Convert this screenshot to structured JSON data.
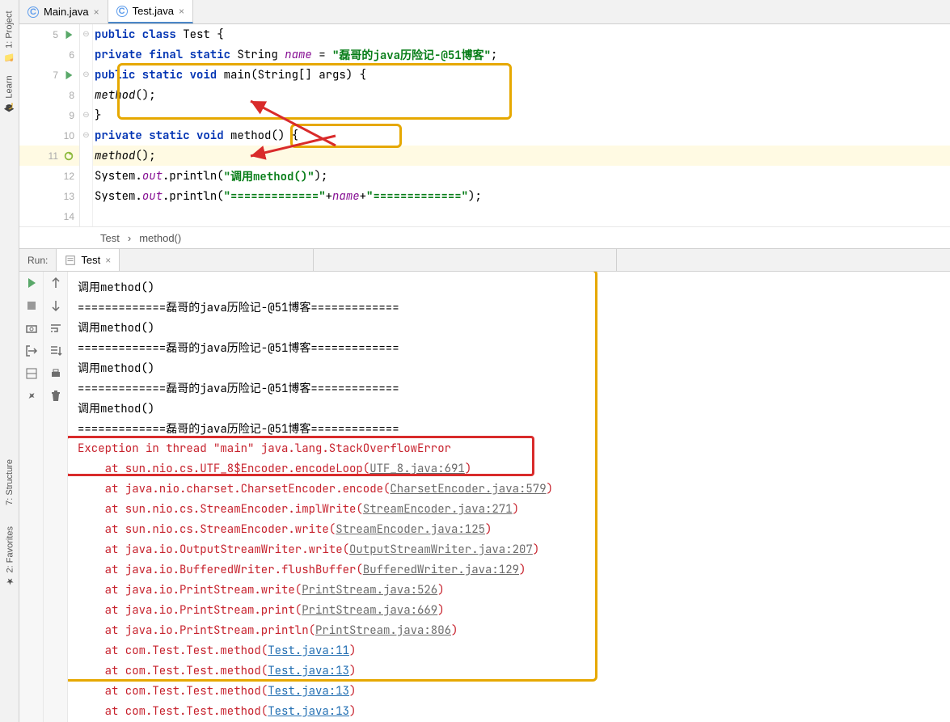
{
  "sidebar": {
    "project": "1: Project",
    "learn": "Learn",
    "structure": "7: Structure",
    "favorites": "2: Favorites"
  },
  "tabs": [
    {
      "label": "Main.java",
      "active": false
    },
    {
      "label": "Test.java",
      "active": true
    }
  ],
  "gutter": {
    "lines": [
      5,
      6,
      7,
      8,
      9,
      10,
      11,
      12,
      13,
      14
    ]
  },
  "code": {
    "l5": {
      "kw1": "public class",
      "rest": " Test {"
    },
    "l6": {
      "kw1": "private final static",
      "type": " String ",
      "fld": "name",
      "eq": " = ",
      "str": "\"磊哥的java历险记-@51博客\"",
      "semi": ";"
    },
    "l7": {
      "kw1": "public static void",
      "rest": " main(String[] args) {"
    },
    "l8": {
      "mth": "method",
      "rest": "();"
    },
    "l9": {
      "rest": "}"
    },
    "l10": {
      "kw1": "private static void",
      "mth": " method",
      "rest": "() {"
    },
    "l11": {
      "mth": "method",
      "rest": "();"
    },
    "l12": {
      "pre": "System.",
      "fld": "out",
      "mid": ".println(",
      "str": "\"调用method()\"",
      "post": ");"
    },
    "l13": {
      "pre": "System.",
      "fld": "out",
      "mid": ".println(",
      "str1": "\"=============\"",
      "plus1": "+",
      "fld2": "name",
      "plus2": "+",
      "str2": "\"=============\"",
      "post": ");"
    }
  },
  "breadcrumb": {
    "cls": "Test",
    "sep": "›",
    "mth": "method()"
  },
  "run": {
    "label": "Run:",
    "tab": "Test"
  },
  "console": [
    {
      "type": "out",
      "text": "调用method()"
    },
    {
      "type": "out",
      "text": "=============磊哥的java历险记-@51博客============="
    },
    {
      "type": "out",
      "text": "调用method()"
    },
    {
      "type": "out",
      "text": "=============磊哥的java历险记-@51博客============="
    },
    {
      "type": "out",
      "text": "调用method()"
    },
    {
      "type": "out",
      "text": "=============磊哥的java历险记-@51博客============="
    },
    {
      "type": "out",
      "text": "调用method()"
    },
    {
      "type": "out",
      "text": "=============磊哥的java历险记-@51博客============="
    },
    {
      "type": "err",
      "pre": "Exception in thread \"main\" java.lang.StackOverflowError"
    },
    {
      "type": "err",
      "pre": "    at sun.nio.cs.UTF_8$Encoder.encodeLoop(",
      "link": "UTF_8.java:691",
      "post": ")"
    },
    {
      "type": "err",
      "pre": "    at java.nio.charset.CharsetEncoder.encode(",
      "link": "CharsetEncoder.java:579",
      "post": ")"
    },
    {
      "type": "err",
      "pre": "    at sun.nio.cs.StreamEncoder.implWrite(",
      "link": "StreamEncoder.java:271",
      "post": ")"
    },
    {
      "type": "err",
      "pre": "    at sun.nio.cs.StreamEncoder.write(",
      "link": "StreamEncoder.java:125",
      "post": ")"
    },
    {
      "type": "err",
      "pre": "    at java.io.OutputStreamWriter.write(",
      "link": "OutputStreamWriter.java:207",
      "post": ")"
    },
    {
      "type": "err",
      "pre": "    at java.io.BufferedWriter.flushBuffer(",
      "link": "BufferedWriter.java:129",
      "post": ")"
    },
    {
      "type": "err",
      "pre": "    at java.io.PrintStream.write(",
      "link": "PrintStream.java:526",
      "post": ")"
    },
    {
      "type": "err",
      "pre": "    at java.io.PrintStream.print(",
      "link": "PrintStream.java:669",
      "post": ")"
    },
    {
      "type": "err",
      "pre": "    at java.io.PrintStream.println(",
      "link": "PrintStream.java:806",
      "post": ")"
    },
    {
      "type": "err",
      "pre": "    at com.Test.Test.method(",
      "link": "Test.java:11",
      "link_blue": true,
      "post": ")"
    },
    {
      "type": "err",
      "pre": "    at com.Test.Test.method(",
      "link": "Test.java:13",
      "link_blue": true,
      "post": ")"
    },
    {
      "type": "err",
      "pre": "    at com.Test.Test.method(",
      "link": "Test.java:13",
      "link_blue": true,
      "post": ")"
    },
    {
      "type": "err",
      "pre": "    at com.Test.Test.method(",
      "link": "Test.java:13",
      "link_blue": true,
      "post": ")"
    }
  ]
}
